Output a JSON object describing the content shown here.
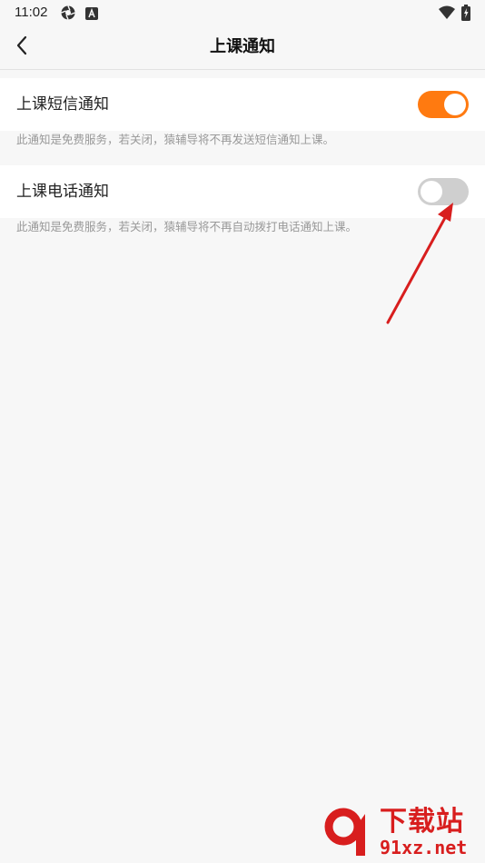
{
  "status_bar": {
    "time": "11:02",
    "left_icons": [
      "aperture-icon",
      "a-badge-icon"
    ],
    "right_icons": [
      "wifi-icon",
      "battery-charging-icon"
    ]
  },
  "header": {
    "back_icon": "chevron-left-icon",
    "title": "上课通知"
  },
  "settings": [
    {
      "label": "上课短信通知",
      "enabled": true,
      "description": "此通知是免费服务，若关闭，猿辅导将不再发送短信通知上课。"
    },
    {
      "label": "上课电话通知",
      "enabled": false,
      "description": "此通知是免费服务，若关闭，猿辅导将不再自动拨打电话通知上课。"
    }
  ],
  "colors": {
    "accent": "#ff7a10",
    "toggle_off": "#cfcfcf",
    "background": "#f7f7f7",
    "card": "#ffffff",
    "annotation_arrow": "#d81e1e",
    "watermark": "#d81e1e"
  },
  "watermark": {
    "site_name": "下载站",
    "domain": "91xz.net"
  }
}
